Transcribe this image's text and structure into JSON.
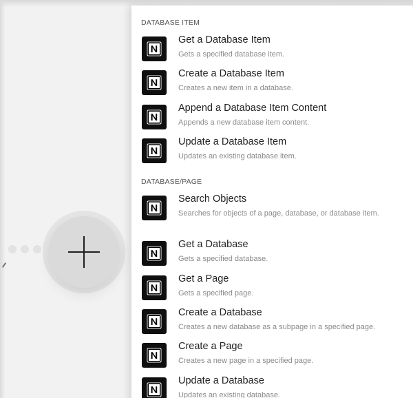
{
  "sections": [
    {
      "header": "DATABASE ITEM",
      "items": [
        {
          "title": "Get a Database Item",
          "desc": "Gets a specified database item.",
          "icon": "notion-icon"
        },
        {
          "title": "Create a Database Item",
          "desc": "Creates a new item in a database.",
          "icon": "notion-icon"
        },
        {
          "title": "Append a Database Item Content",
          "desc": "Appends a new database item content.",
          "icon": "notion-icon"
        },
        {
          "title": "Update a Database Item",
          "desc": "Updates an existing database item.",
          "icon": "notion-icon"
        }
      ]
    },
    {
      "header": "DATABASE/PAGE",
      "items": [
        {
          "title": "Search Objects",
          "desc": "Searches for objects of a page, database, or database item.",
          "icon": "notion-icon"
        },
        {
          "title": "Get a Database",
          "desc": "Gets a specified database.",
          "icon": "notion-icon"
        },
        {
          "title": "Get a Page",
          "desc": "Gets a specified page.",
          "icon": "notion-icon"
        },
        {
          "title": "Create a Database",
          "desc": "Creates a new database as a subpage in a specified page.",
          "icon": "notion-icon"
        },
        {
          "title": "Create a Page",
          "desc": "Creates a new page in a specified page.",
          "icon": "notion-icon"
        },
        {
          "title": "Update a Database",
          "desc": "Updates an existing database.",
          "icon": "notion-icon"
        }
      ]
    }
  ],
  "canvas": {
    "add_button_icon": "plus-icon",
    "background": "#f2f2f2",
    "panel_background": "#ffffff"
  }
}
